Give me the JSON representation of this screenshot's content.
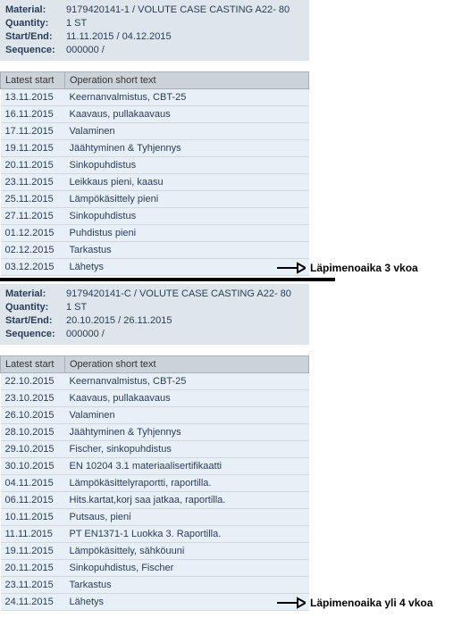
{
  "labels": {
    "material": "Material:",
    "quantity": "Quantity:",
    "startend": "Start/End:",
    "sequence": "Sequence:",
    "latest_start": "Latest start",
    "operation_short_text": "Operation short text"
  },
  "blocks": [
    {
      "header": {
        "material": "9179420141-1 / VOLUTE CASE CASTING A22- 80",
        "quantity": "1 ST",
        "startend": "11.11.2015 / 04.12.2015",
        "sequence": "000000 /"
      },
      "rows": [
        {
          "date": "13.11.2015",
          "op": "Keernanvalmistus, CBT-25"
        },
        {
          "date": "16.11.2015",
          "op": "Kaavaus, pullakaavaus"
        },
        {
          "date": "17.11.2015",
          "op": "Valaminen"
        },
        {
          "date": "19.11.2015",
          "op": "Jäähtyminen & Tyhjennys"
        },
        {
          "date": "20.11.2015",
          "op": "Sinkopuhdistus"
        },
        {
          "date": "23.11.2015",
          "op": "Leikkaus pieni, kaasu"
        },
        {
          "date": "25.11.2015",
          "op": "Lämpökäsittely pieni"
        },
        {
          "date": "27.11.2015",
          "op": "Sinkopuhdistus"
        },
        {
          "date": "01.12.2015",
          "op": "Puhdistus pieni"
        },
        {
          "date": "02.12.2015",
          "op": "Tarkastus"
        },
        {
          "date": "03.12.2015",
          "op": "Lähetys"
        }
      ],
      "annotation": "Läpimenoaika 3 vkoa"
    },
    {
      "header": {
        "material": "9179420141-C / VOLUTE CASE CASTING A22- 80",
        "quantity": "1 ST",
        "startend": "20.10.2015 / 26.11.2015",
        "sequence": "000000 /"
      },
      "rows": [
        {
          "date": "22.10.2015",
          "op": "Keernanvalmistus, CBT-25"
        },
        {
          "date": "23.10.2015",
          "op": "Kaavaus, pullakaavaus"
        },
        {
          "date": "26.10.2015",
          "op": "Valaminen"
        },
        {
          "date": "28.10.2015",
          "op": "Jäähtyminen & Tyhjennys"
        },
        {
          "date": "29.10.2015",
          "op": "Fischer, sinkopuhdistus"
        },
        {
          "date": "30.10.2015",
          "op": "EN 10204 3.1 materiaalisertifikaatti"
        },
        {
          "date": "04.11.2015",
          "op": "Lämpökäsittelyraportti, raportilla."
        },
        {
          "date": "06.11.2015",
          "op": "Hits.kartat,korj saa jatkaa, raportilla."
        },
        {
          "date": "10.11.2015",
          "op": "Putsaus, pieni"
        },
        {
          "date": "11.11.2015",
          "op": "PT EN1371-1 Luokka 3. Raportilla."
        },
        {
          "date": "19.11.2015",
          "op": "Lämpökäsittely, sähköuuni"
        },
        {
          "date": "20.11.2015",
          "op": "Sinkopuhdistus, Fischer"
        },
        {
          "date": "23.11.2015",
          "op": "Tarkastus"
        },
        {
          "date": "24.11.2015",
          "op": "Lähetys"
        }
      ],
      "annotation": "Läpimenoaika yli 4 vkoa"
    }
  ]
}
